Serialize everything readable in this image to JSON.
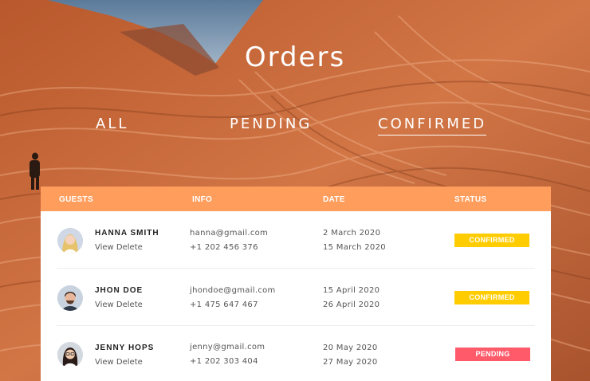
{
  "page": {
    "title": "Orders"
  },
  "tabs": [
    {
      "label": "ALL",
      "active": false
    },
    {
      "label": "PENDING",
      "active": false
    },
    {
      "label": "CONFIRMED",
      "active": true
    }
  ],
  "table": {
    "headers": {
      "guests": "GUESTS",
      "info": "INFO",
      "date": "DATE",
      "status": "STATUS"
    },
    "rows": [
      {
        "name": "HANNA SMITH",
        "view": "View",
        "delete": "Delete",
        "email": "hanna@gmail.com",
        "phone": "+1 202 456 376",
        "date_from": "2 March 2020",
        "date_to": "15 March 2020",
        "status": "CONFIRMED",
        "status_color": "#ffcc00"
      },
      {
        "name": "JHON DOE",
        "view": "View",
        "delete": "Delete",
        "email": "jhondoe@gmail.com",
        "phone": "+1 475 647 467",
        "date_from": "15 April 2020",
        "date_to": "26 April 2020",
        "status": "CONFIRMED",
        "status_color": "#ffcc00"
      },
      {
        "name": "JENNY HOPS",
        "view": "View",
        "delete": "Delete",
        "email": "jenny@gmail.com",
        "phone": "+1 202 303 404",
        "date_from": "20 May 2020",
        "date_to": "27 May 2020",
        "status": "PENDING",
        "status_color": "#ff5a6a"
      }
    ]
  },
  "colors": {
    "header_bg": "#ff9d5c",
    "confirmed": "#ffcc00",
    "pending": "#ff5a6a"
  }
}
